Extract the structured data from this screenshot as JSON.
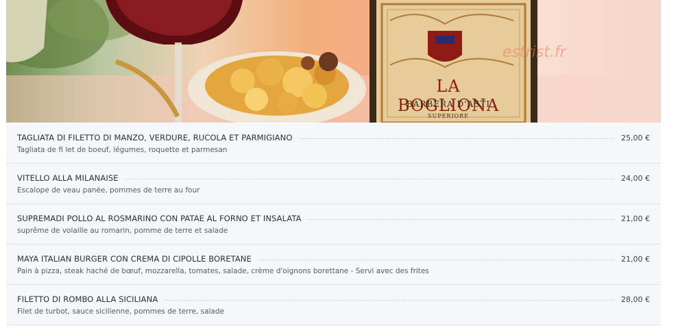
{
  "hero": {
    "brand": "LA BOGLIONA",
    "subtitle": "BARBERA D'ASTI",
    "subtitle2": "SUPERIORE",
    "watermark": "estrist.fr"
  },
  "menu": {
    "items": [
      {
        "name": "TAGLIATA DI FILETTO DI MANZO, VERDURE, RUCOLA ET PARMIGIANO",
        "description": "Tagliata de fi let de boeuf, légumes, roquette et parmesan",
        "price": "25,00 €"
      },
      {
        "name": "VITELLO ALLA MILANAISE",
        "description": "Escalope de veau panée, pommes de terre au four",
        "price": "24,00 €"
      },
      {
        "name": "SUPREMADI POLLO AL ROSMARINO CON PATAE AL FORNO ET INSALATA",
        "description": "suprême de volaille au romarin, pomme de terre et salade",
        "price": "21,00 €"
      },
      {
        "name": "MAYA ITALIAN BURGER CON CREMA DI CIPOLLE BORETANE",
        "description": "Pain à pizza, steak haché de bœuf, mozzarella, tomates, salade, crème d'oignons borettane - Servi avec des frites",
        "price": "21,00 €"
      },
      {
        "name": "FILETTO DI ROMBO ALLA SICILIANA",
        "description": "Filet de turbot, sauce sicilienne, pommes de terre, salade",
        "price": "28,00 €"
      }
    ]
  }
}
